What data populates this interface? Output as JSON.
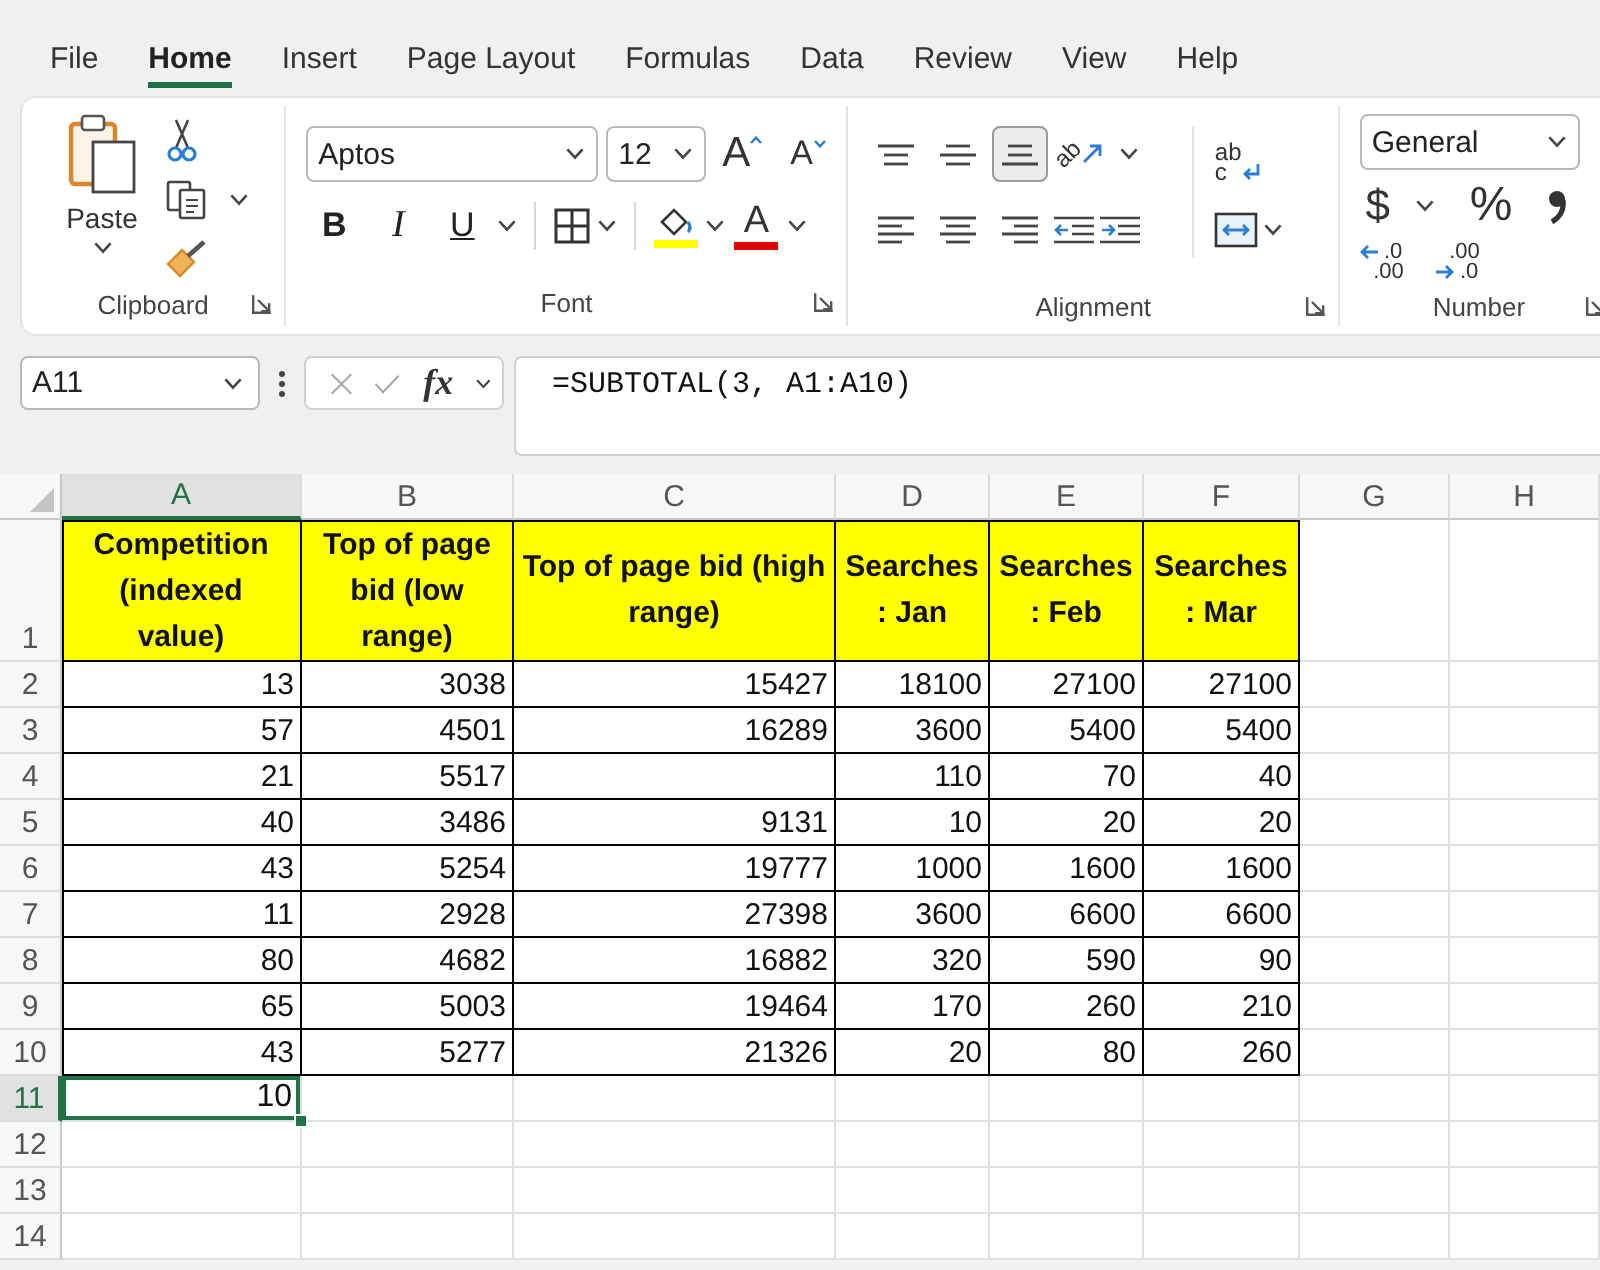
{
  "menu_tabs": [
    {
      "label": "File",
      "selected": false
    },
    {
      "label": "Home",
      "selected": true
    },
    {
      "label": "Insert",
      "selected": false
    },
    {
      "label": "Page Layout",
      "selected": false
    },
    {
      "label": "Formulas",
      "selected": false
    },
    {
      "label": "Data",
      "selected": false
    },
    {
      "label": "Review",
      "selected": false
    },
    {
      "label": "View",
      "selected": false
    },
    {
      "label": "Help",
      "selected": false
    }
  ],
  "ribbon": {
    "clipboard": {
      "label": "Clipboard",
      "paste_label": "Paste"
    },
    "font": {
      "label": "Font",
      "font_name": "Aptos",
      "font_size": "12",
      "grow_glyph": "A",
      "shrink_glyph": "A",
      "styles": [
        {
          "kind": "bold",
          "glyph": "B"
        },
        {
          "kind": "italic",
          "glyph": "I"
        },
        {
          "kind": "underline",
          "glyph": "U"
        }
      ],
      "font_color_glyph": "A"
    },
    "alignment": {
      "label": "Alignment",
      "vertical": [
        {
          "kind": "top",
          "selected": false
        },
        {
          "kind": "middle",
          "selected": false
        },
        {
          "kind": "bottom",
          "selected": true
        }
      ],
      "orientation_glyph": "ab",
      "horizontal": [
        {
          "kind": "left",
          "selected": false
        },
        {
          "kind": "center",
          "selected": false
        },
        {
          "kind": "right",
          "selected": false
        }
      ],
      "wrap_glyphs": [
        "ab",
        "c"
      ]
    },
    "number": {
      "label": "Number",
      "format": "General",
      "currency_glyph": "$",
      "percent_glyph": "%",
      "increase_decimal": [
        ".0",
        ".00"
      ],
      "decrease_decimal": [
        ".00",
        ".0"
      ]
    }
  },
  "formula_bar": {
    "name_box": "A11",
    "edit_buttons": [
      {
        "kind": "cancel",
        "disabled": true
      },
      {
        "kind": "enter",
        "disabled": true
      }
    ],
    "fx_glyph": "fx",
    "formula": "=SUBTOTAL(3, A1:A10)"
  },
  "sheet": {
    "columns": [
      {
        "label": "A",
        "selected": true
      },
      {
        "label": "B",
        "selected": false
      },
      {
        "label": "C",
        "selected": false
      },
      {
        "label": "D",
        "selected": false
      },
      {
        "label": "E",
        "selected": false
      },
      {
        "label": "F",
        "selected": false
      },
      {
        "label": "G",
        "selected": false
      },
      {
        "label": "H",
        "selected": false
      }
    ],
    "rows": [
      {
        "label": "1",
        "selected": false,
        "kind": "header",
        "cells": [
          "Competition (indexed value)",
          "Top of page bid (low range)",
          "Top of page bid (high range)",
          "Searches : Jan",
          "Searches : Feb",
          "Searches : Mar"
        ]
      },
      {
        "label": "2",
        "selected": false,
        "kind": "data",
        "cells": [
          "13",
          "3038",
          "15427",
          "18100",
          "27100",
          "27100"
        ]
      },
      {
        "label": "3",
        "selected": false,
        "kind": "data",
        "cells": [
          "57",
          "4501",
          "16289",
          "3600",
          "5400",
          "5400"
        ]
      },
      {
        "label": "4",
        "selected": false,
        "kind": "data",
        "cells": [
          "21",
          "5517",
          null,
          "110",
          "70",
          "40"
        ]
      },
      {
        "label": "5",
        "selected": false,
        "kind": "data",
        "cells": [
          "40",
          "3486",
          "9131",
          "10",
          "20",
          "20"
        ]
      },
      {
        "label": "6",
        "selected": false,
        "kind": "data",
        "cells": [
          "43",
          "5254",
          "19777",
          "1000",
          "1600",
          "1600"
        ]
      },
      {
        "label": "7",
        "selected": false,
        "kind": "data",
        "cells": [
          "11",
          "2928",
          "27398",
          "3600",
          "6600",
          "6600"
        ]
      },
      {
        "label": "8",
        "selected": false,
        "kind": "data",
        "cells": [
          "80",
          "4682",
          "16882",
          "320",
          "590",
          "90"
        ]
      },
      {
        "label": "9",
        "selected": false,
        "kind": "data",
        "cells": [
          "65",
          "5003",
          "19464",
          "170",
          "260",
          "210"
        ]
      },
      {
        "label": "10",
        "selected": false,
        "kind": "data",
        "cells": [
          "43",
          "5277",
          "21326",
          "20",
          "80",
          "260"
        ]
      },
      {
        "label": "11",
        "selected": true,
        "kind": "plain",
        "cells": [
          "10"
        ]
      },
      {
        "label": "12",
        "selected": false,
        "kind": "plain"
      },
      {
        "label": "13",
        "selected": false,
        "kind": "plain"
      },
      {
        "label": "14",
        "selected": false,
        "kind": "plain"
      }
    ]
  }
}
